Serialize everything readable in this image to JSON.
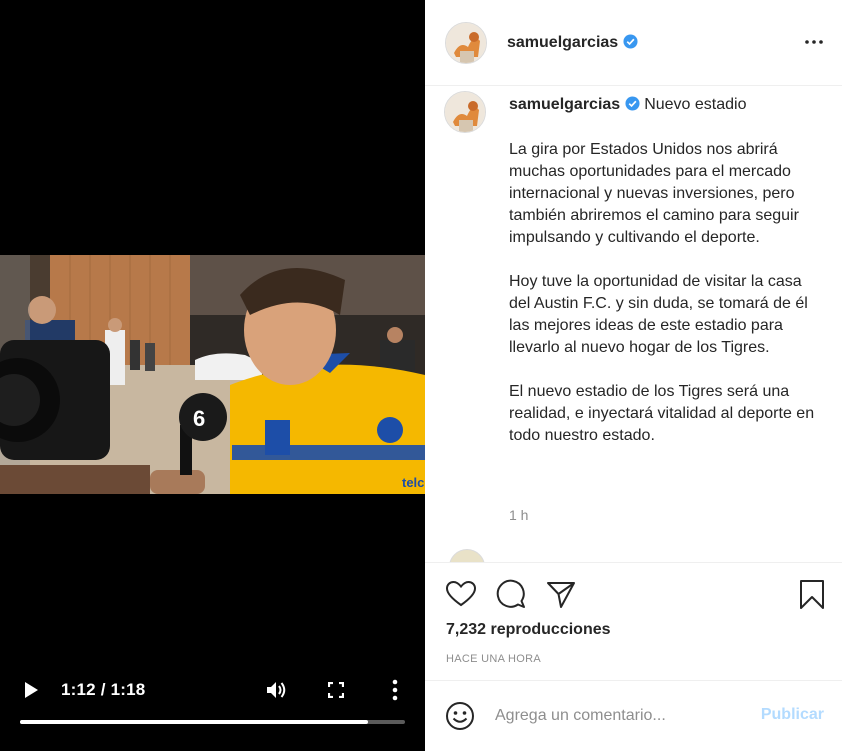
{
  "video": {
    "time": "1:12 / 1:18",
    "progress": 0.904,
    "channel_logo_text": "6",
    "jersey_sponsor": "telcel"
  },
  "header": {
    "username": "samuelgarcias",
    "verified": true,
    "more_icon": "more-horizontal-icon"
  },
  "caption": {
    "username": "samuelgarcias",
    "title": "Nuevo estadio",
    "paragraphs": [
      "La gira por Estados Unidos nos abrirá muchas oportunidades para el mercado internacional y nuevas inversiones, pero también abriremos el camino para seguir impulsando y cultivando el deporte.",
      "Hoy tuve la oportunidad de visitar la casa del Austin F.C. y sin duda, se tomará de él las mejores ideas de este estadio para llevarlo al nuevo hogar de los Tigres.",
      "El nuevo estadio de los Tigres será una realidad, e inyectará vitalidad al deporte en todo nuestro estado."
    ],
    "timestamp": "1 h"
  },
  "actions": {
    "views": "7,232 reproducciones",
    "age": "HACE UNA HORA"
  },
  "comment_box": {
    "placeholder": "Agrega un comentario...",
    "post_label": "Publicar"
  },
  "colors": {
    "verified_blue": "#3897f0",
    "post_disabled": "#b3dbff",
    "jersey_yellow": "#f5b800",
    "jersey_blue": "#1d4ea8"
  }
}
